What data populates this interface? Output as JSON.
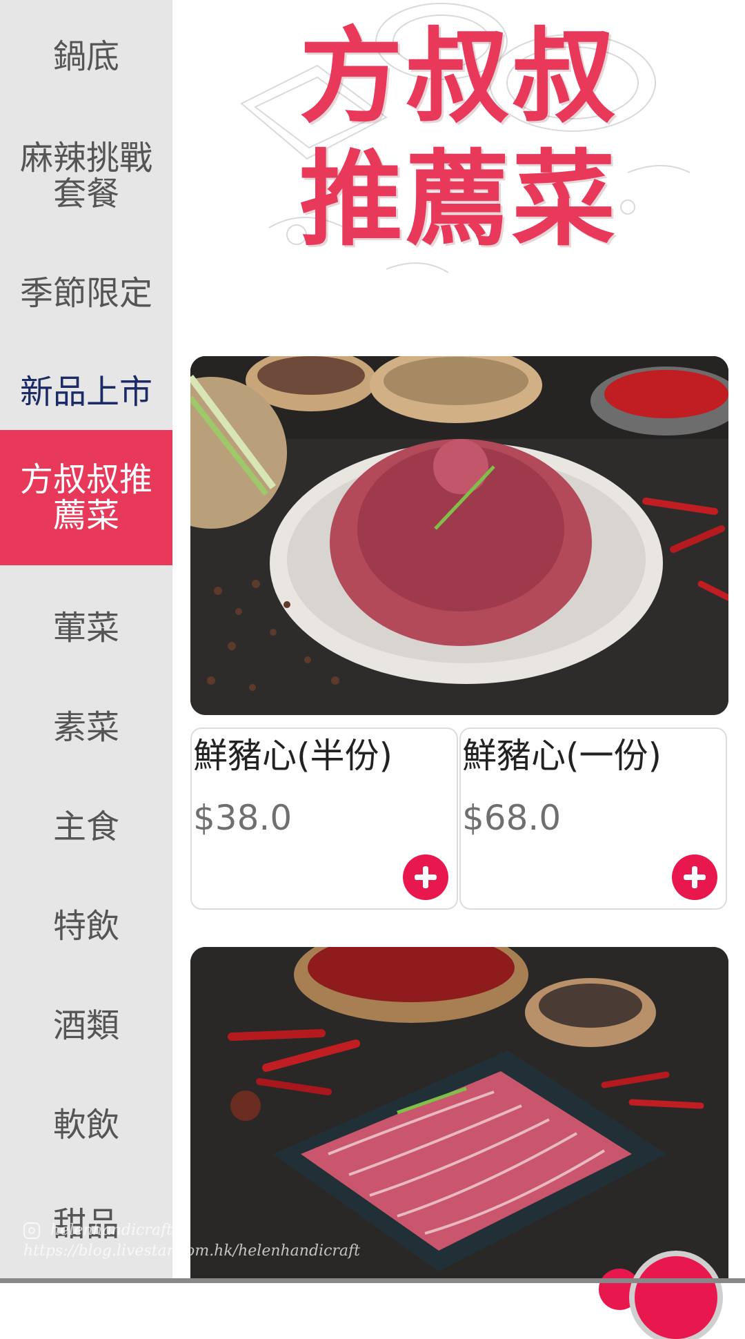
{
  "sidebar": {
    "items": [
      {
        "label": "鍋底"
      },
      {
        "label": "麻辣挑戰套餐"
      },
      {
        "label": "季節限定"
      },
      {
        "label": "新品上市"
      },
      {
        "label": "方叔叔推薦菜"
      },
      {
        "label": "葷菜"
      },
      {
        "label": "素菜"
      },
      {
        "label": "主食"
      },
      {
        "label": "特飲"
      },
      {
        "label": "酒類"
      },
      {
        "label": "軟飲"
      },
      {
        "label": "甜品"
      }
    ],
    "active_index": 4,
    "highlight_color": "#e8395a"
  },
  "banner": {
    "line1": "方叔叔",
    "line2": "推薦菜"
  },
  "products": [
    {
      "name": "鮮豬心(半份)",
      "price": "$38.0",
      "add_icon": "plus-circle-icon"
    },
    {
      "name": "鮮豬心(一份)",
      "price": "$68.0",
      "add_icon": "plus-circle-icon"
    }
  ],
  "watermark": {
    "handle": "helenhandicraft",
    "url": "https://blog.livestar.com.hk/helenhandicraft"
  },
  "colors": {
    "accent": "#e8174d",
    "sidebar_bg": "#e6e6e6",
    "new_item_text": "#1c2a66"
  }
}
